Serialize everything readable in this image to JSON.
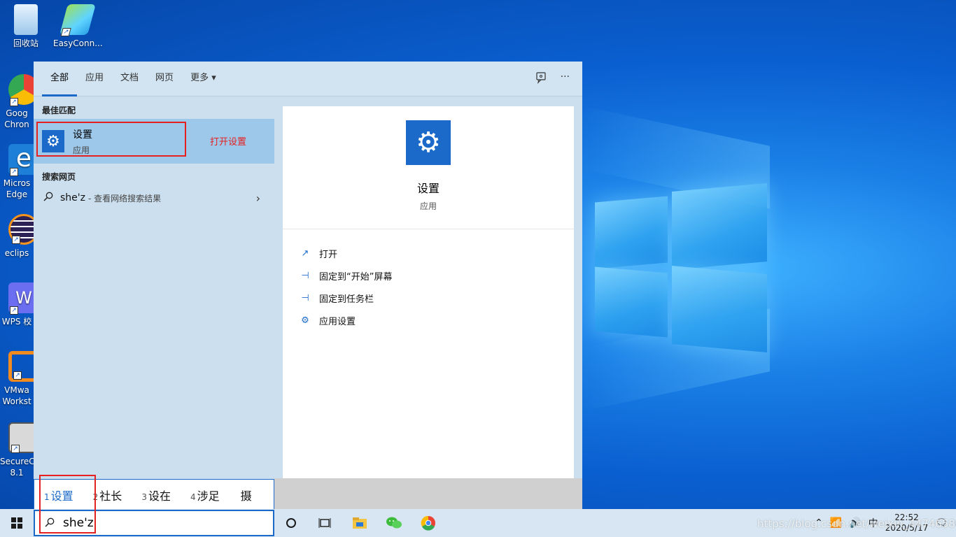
{
  "desktop": {
    "icons": [
      {
        "label": "回收站",
        "icon": "recycle-bin-icon"
      },
      {
        "label": "EasyConn...",
        "icon": "easyconnect-icon"
      },
      {
        "label": "Goog Chron",
        "icon": "chrome-icon"
      },
      {
        "label": "Micros Edge",
        "icon": "edge-icon"
      },
      {
        "label": "eclips",
        "icon": "eclipse-icon"
      },
      {
        "label": "WPS 校",
        "icon": "wps-icon"
      },
      {
        "label": "VMwa Workst",
        "icon": "vmware-icon"
      },
      {
        "label": "SecureC 8.1",
        "icon": "securecrt-icon"
      }
    ]
  },
  "search_panel": {
    "tabs": [
      {
        "label": "全部",
        "active": true
      },
      {
        "label": "应用"
      },
      {
        "label": "文档"
      },
      {
        "label": "网页"
      },
      {
        "label": "更多 ▾"
      }
    ],
    "tab_icons": [
      "feedback-icon",
      "more-options-icon"
    ],
    "more_glyph": "···",
    "best_match_title": "最佳匹配",
    "best_match": {
      "title": "设置",
      "subtitle": "应用",
      "note": "打开设置"
    },
    "web_title": "搜索网页",
    "web_result": {
      "query": "she'z",
      "hint": "- 查看网络搜索结果",
      "chevron": "›"
    },
    "detail": {
      "title": "设置",
      "subtitle": "应用",
      "actions": [
        {
          "label": "打开",
          "icon": "open-icon",
          "glyph": "↗"
        },
        {
          "label": "固定到“开始”屏幕",
          "icon": "pin-icon",
          "glyph": "⊣"
        },
        {
          "label": "固定到任务栏",
          "icon": "pin-icon",
          "glyph": "⊣"
        },
        {
          "label": "应用设置",
          "icon": "gear-icon",
          "glyph": "⚙"
        }
      ]
    }
  },
  "ime": {
    "candidates": [
      {
        "n": "1",
        "text": "设置"
      },
      {
        "n": "2",
        "text": "社长"
      },
      {
        "n": "3",
        "text": "设在"
      },
      {
        "n": "4",
        "text": "涉足"
      },
      {
        "n": "",
        "text": "摄"
      }
    ]
  },
  "taskbar": {
    "search_text": "she'z",
    "tray_lang": "中",
    "clock_time": "22:52",
    "clock_date": "2020/5/17",
    "watermark": "https://blog.csdn.net/weixin_44746580",
    "colors": {
      "accent": "#1b6ac9",
      "highlight": "#e52020"
    }
  }
}
